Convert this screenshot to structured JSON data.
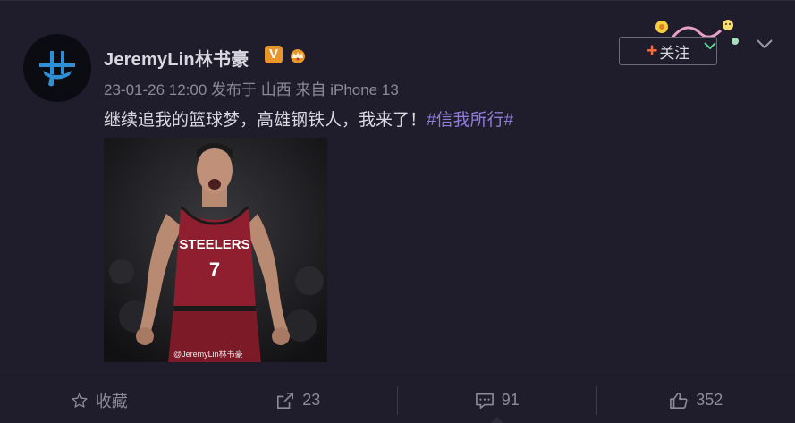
{
  "post": {
    "username": "JeremyLin林书豪",
    "badge_v": "V",
    "meta": "23-01-26 12:00 发布于 山西 来自 iPhone 13",
    "text": "继续追我的篮球梦，高雄钢铁人，我来了！",
    "hashtag": "#信我所行#",
    "photo_watermark": "@JeremyLin林书豪",
    "jersey_text": "STEELERS",
    "jersey_number": "7"
  },
  "header": {
    "follow_plus": "+",
    "follow_label": "关注"
  },
  "actions": {
    "favorite_label": "收藏",
    "repost_count": "23",
    "comment_count": "91",
    "like_count": "352"
  },
  "colors": {
    "background": "#1f1c2c",
    "hashtag": "#8f7bd6",
    "follow_plus": "#ff6a3c",
    "badge_v": "#e8962a"
  },
  "icons": [
    "chevron-down-icon",
    "star-icon",
    "repost-icon",
    "comment-icon",
    "thumbs-up-icon",
    "crown-icon"
  ]
}
